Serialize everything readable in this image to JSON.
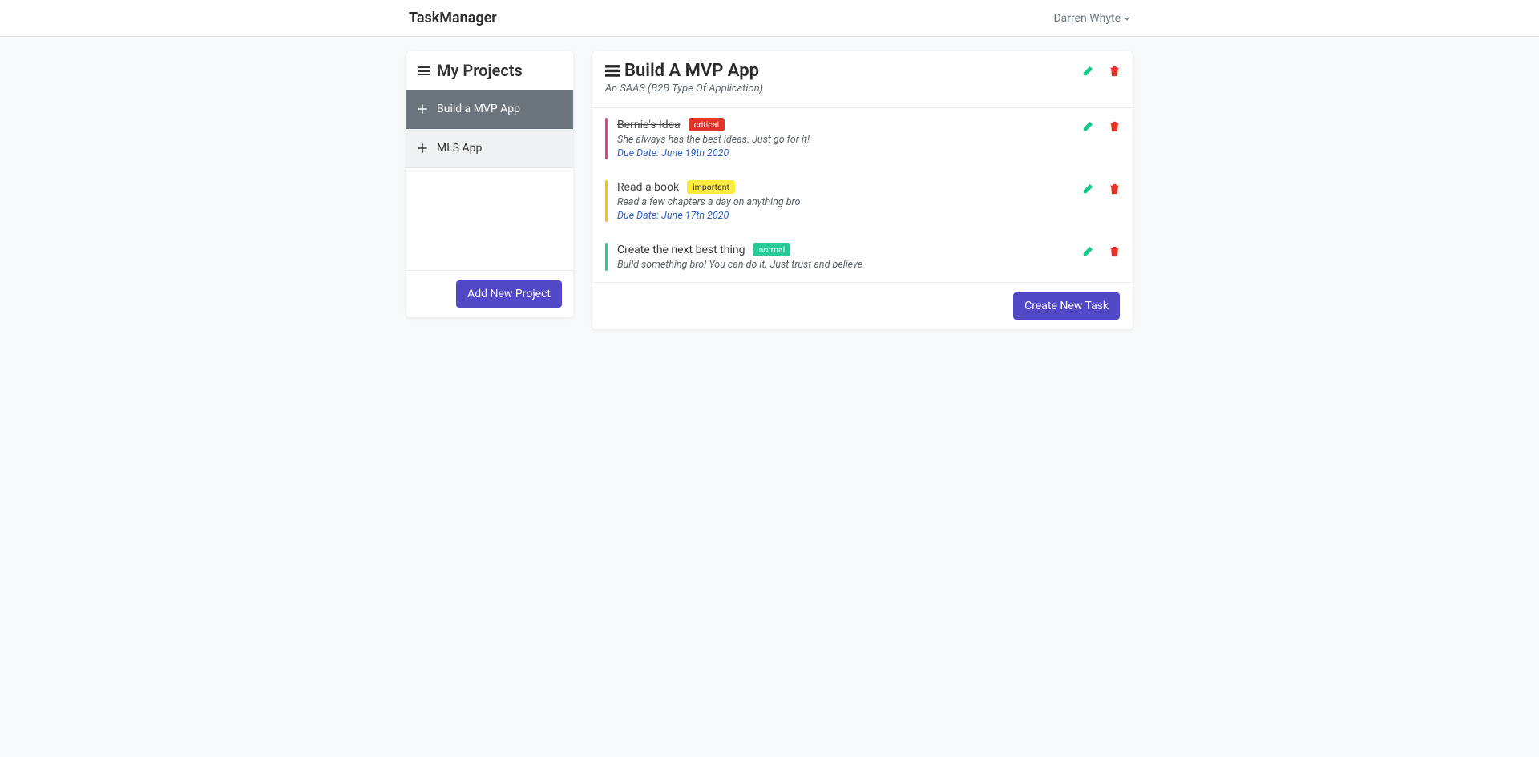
{
  "navbar": {
    "brand": "TaskManager",
    "user": "Darren Whyte"
  },
  "sidebar": {
    "title": "My Projects",
    "items": [
      {
        "label": "Build a MVP App",
        "active": true
      },
      {
        "label": "MLS App",
        "active": false
      }
    ],
    "add_button": "Add New Project"
  },
  "main": {
    "title": "Build A MVP App",
    "subtitle": "An SAAS (B2B Type Of Application)",
    "tasks": [
      {
        "title": "Bernie's Idea",
        "done": true,
        "priority": "critical",
        "priority_label": "critical",
        "desc": "She always has the best ideas. Just go for it!",
        "due": "Due Date: June 19th 2020"
      },
      {
        "title": "Read a book",
        "done": true,
        "priority": "important",
        "priority_label": "important",
        "desc": "Read a few chapters a day on anything bro",
        "due": "Due Date: June 17th 2020"
      },
      {
        "title": "Create the next best thing",
        "done": false,
        "priority": "normal",
        "priority_label": "normal",
        "desc": "Build something bro! You can do it. Just trust and believe",
        "due": null
      }
    ],
    "create_button": "Create New Task"
  }
}
